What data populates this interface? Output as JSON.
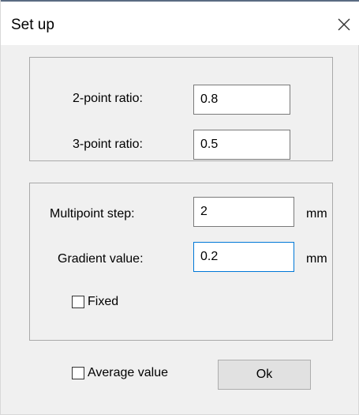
{
  "window": {
    "title": "Set up",
    "close_icon": "close-icon"
  },
  "ratio_group": {
    "two_point_label": "2-point ratio:",
    "two_point_value": "0.8",
    "three_point_label": "3-point ratio:",
    "three_point_value": "0.5"
  },
  "step_group": {
    "multipoint_step_label": "Multipoint step:",
    "multipoint_step_value": "2",
    "multipoint_step_unit": "mm",
    "gradient_value_label": "Gradient value:",
    "gradient_value_value": "0.2",
    "gradient_value_unit": "mm",
    "fixed_label": "Fixed",
    "fixed_checked": false
  },
  "footer": {
    "average_value_label": "Average value",
    "average_value_checked": false,
    "ok_label": "Ok"
  },
  "colors": {
    "dialog_background": "#f0f0f0",
    "title_background": "#ffffff",
    "focus_border": "#0078d7",
    "group_border": "#a9a9a9",
    "button_background": "#e1e1e1"
  }
}
